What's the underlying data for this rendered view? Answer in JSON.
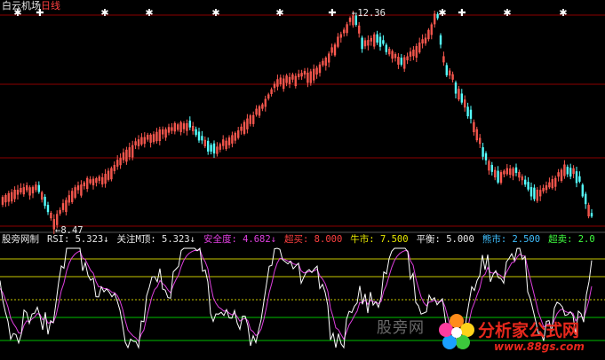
{
  "header": {
    "stock_name": "白云机场",
    "period": "日线"
  },
  "main_chart": {
    "high_label": "12.36",
    "low_label": "8.47",
    "marker_glyphs": [
      "✱",
      "✚",
      "✱",
      "✱",
      "✱",
      "✱",
      "✚",
      "✱",
      "✚",
      "✱",
      "✱"
    ]
  },
  "indicator_bar": {
    "name": "股旁网制",
    "rsi": "RSI: 5.323↓",
    "watch": "关注M顶: 5.323↓",
    "safety": "安全度: 4.682↓",
    "overbought": "超买: 8.000",
    "bull": "牛市: 7.500",
    "balance": "平衡: 5.000",
    "bear": "熊市: 2.500",
    "oversold": "超卖: 2.0"
  },
  "watermark": {
    "text": "股旁网",
    "site": "分析家公式网",
    "url": "www.88gs.com"
  },
  "colors": {
    "up_candle": "#ff5a50",
    "down_candle": "#54ffff",
    "grid": "#8b0000",
    "white_line": "#ffffff",
    "magenta_line": "#e040e0",
    "level_yellow": "#c8c800",
    "level_green": "#00c000"
  }
}
